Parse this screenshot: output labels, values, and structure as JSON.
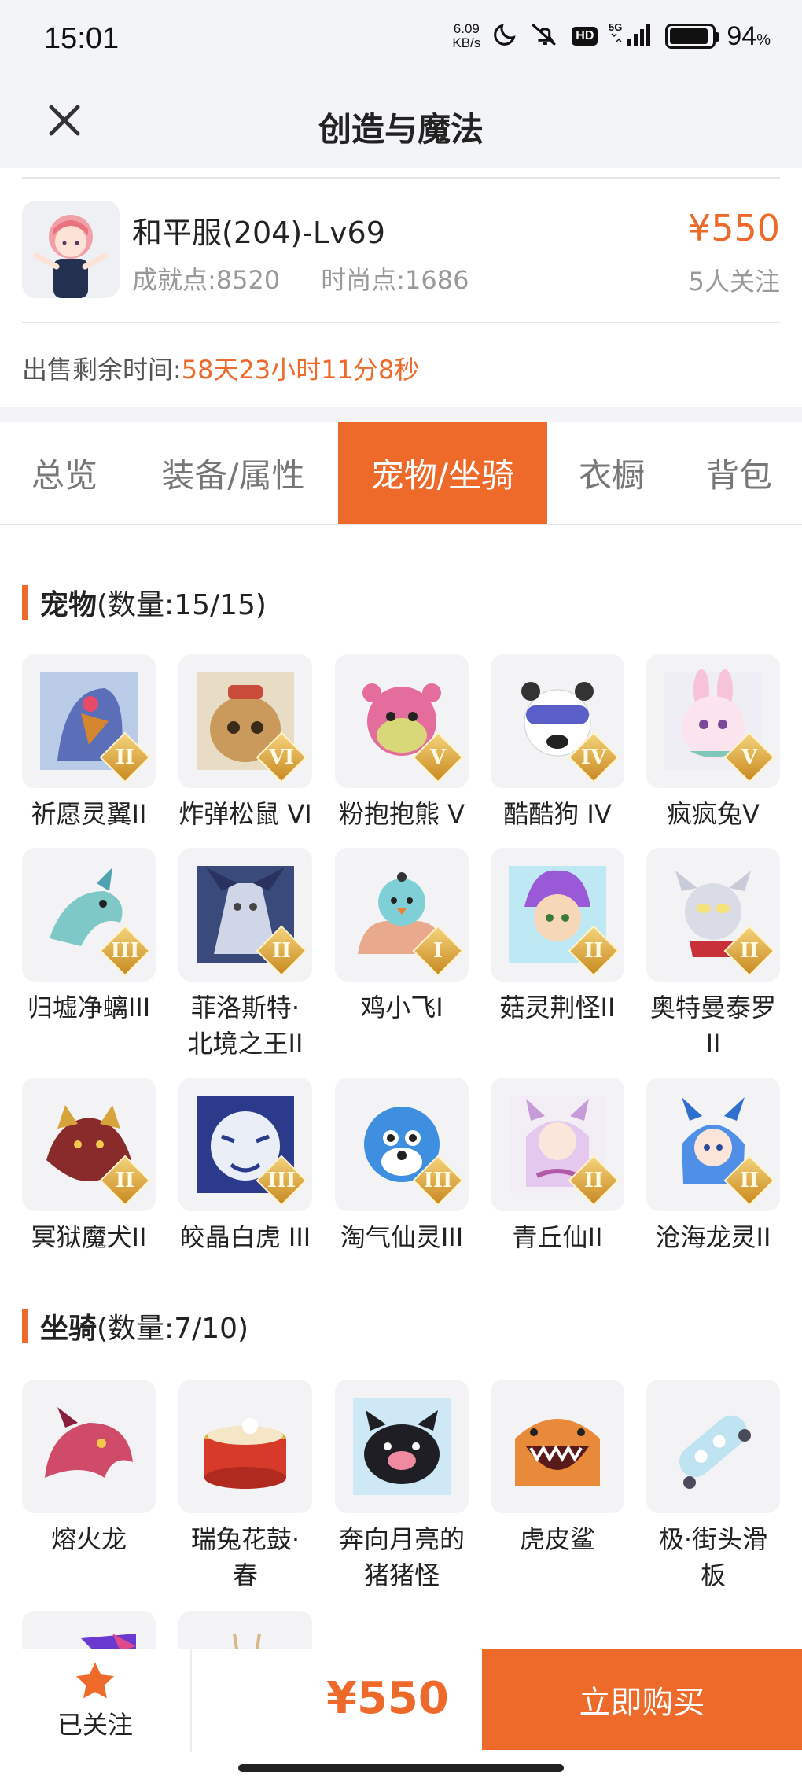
{
  "status_bar": {
    "time": "15:01",
    "net_speed_value": "6.09",
    "net_speed_unit": "KB/s",
    "hd_badge": "HD",
    "network": "5G",
    "battery_percent": "94",
    "battery_symbol": "%",
    "icons": [
      "moon-icon",
      "mute-icon",
      "hd-icon",
      "signal-icon",
      "battery-icon"
    ]
  },
  "nav": {
    "title": "创造与魔法",
    "close_icon": "close-icon"
  },
  "account": {
    "name": "和平服(204)-Lv69",
    "achievement": "成就点:8520",
    "fashion": "时尚点:1686",
    "price": "¥550",
    "followers": "5人关注",
    "remaining_label": "出售剩余时间:",
    "remaining_value": "58天23小时11分8秒"
  },
  "tabs": [
    {
      "label": "总览"
    },
    {
      "label": "装备/属性"
    },
    {
      "label": "宠物/坐骑",
      "active": true
    },
    {
      "label": "衣橱"
    },
    {
      "label": "背包"
    }
  ],
  "pets_section": {
    "title": "宠物",
    "count": "(数量:15/15)",
    "items": [
      {
        "name": "祈愿灵翼II",
        "rank": "II"
      },
      {
        "name": "炸弹松鼠 VI",
        "rank": "VI"
      },
      {
        "name": "粉抱抱熊 V",
        "rank": "V"
      },
      {
        "name": "酷酷狗 IV",
        "rank": "IV"
      },
      {
        "name": "疯疯兔V",
        "rank": "V"
      },
      {
        "name": "归墟净螭III",
        "rank": "III"
      },
      {
        "name": "菲洛斯特·北境之王II",
        "rank": "II"
      },
      {
        "name": "鸡小飞I",
        "rank": "I"
      },
      {
        "name": "菇灵荆怪II",
        "rank": "II"
      },
      {
        "name": "奥特曼泰罗II",
        "rank": "II"
      },
      {
        "name": "冥狱魔犬II",
        "rank": "II"
      },
      {
        "name": "皎晶白虎 III",
        "rank": "III"
      },
      {
        "name": "淘气仙灵III",
        "rank": "III"
      },
      {
        "name": "青丘仙II",
        "rank": "II"
      },
      {
        "name": "沧海龙灵II",
        "rank": "II"
      }
    ]
  },
  "mounts_section": {
    "title": "坐骑",
    "count": "(数量:7/10)",
    "items": [
      {
        "name": "熔火龙"
      },
      {
        "name": "瑞兔花鼓·春"
      },
      {
        "name": "奔向月亮的猪猪怪"
      },
      {
        "name": "虎皮鲨"
      },
      {
        "name": "极·街头滑板"
      }
    ]
  },
  "bottom": {
    "follow_label": "已关注",
    "price": "¥550",
    "buy_label": "立即购买",
    "accent": "#ee6a2b"
  }
}
